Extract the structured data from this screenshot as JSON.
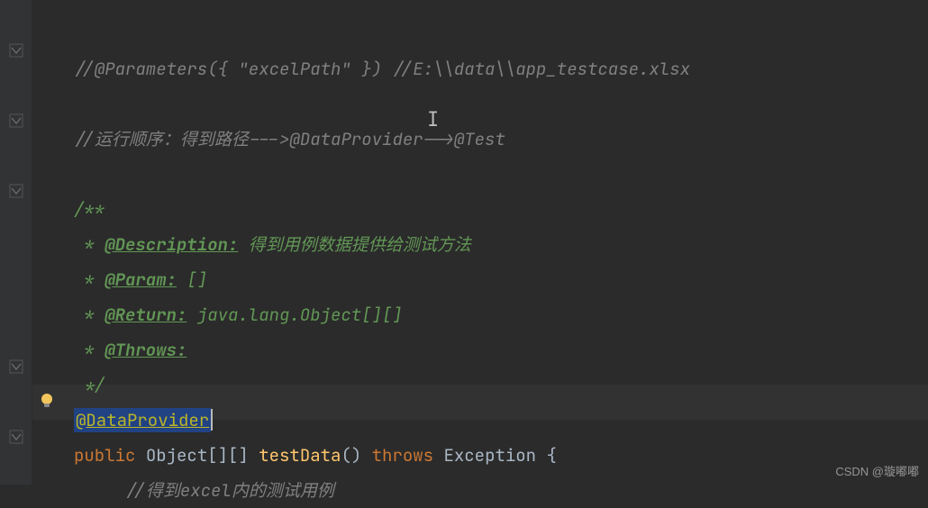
{
  "editor": {
    "lines": {
      "comment1": "//@Parameters({ \"excelPath\" }) //E:\\\\data\\\\app_testcase.xlsx",
      "comment2_prefix": "//",
      "comment2_a": "运行顺序：得到路径",
      "comment2_b": "--->@Data",
      "comment2_c": "Provider-->@Test",
      "javadoc_start": "/**",
      "javadoc_desc_tag": "@Description:",
      "javadoc_desc_text": " 得到用例数据提供给测试方法",
      "javadoc_param_tag": "@Param:",
      "javadoc_param_text": " []",
      "javadoc_return_tag": "@Return:",
      "javadoc_return_text": " java.lang.Object[][]",
      "javadoc_throws_tag": "@Throws:",
      "javadoc_end": " */",
      "annotation_at": "@",
      "annotation_name": "DataProvider",
      "kw_public": "public",
      "type_object": "Object[][]",
      "method_name": "testData",
      "parens": "()",
      "kw_throws": "throws",
      "exc_type": "Exception",
      "open_brace": "{",
      "comment3": "//得到excel内的测试用例",
      "star": " * "
    },
    "text_cursor": "I"
  },
  "watermark": "CSDN @璇嘟嘟"
}
